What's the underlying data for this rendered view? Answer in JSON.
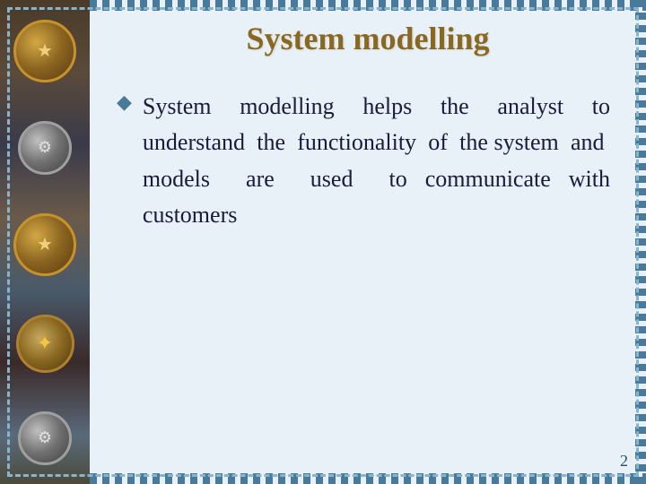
{
  "slide": {
    "title": "System modelling",
    "page_number": "2",
    "bullet": {
      "text_lines": [
        "System modelling helps the analyst to",
        "understand  the  functionality  of  the",
        "system  and  models  are  used  to",
        "communicate with customers"
      ]
    }
  }
}
